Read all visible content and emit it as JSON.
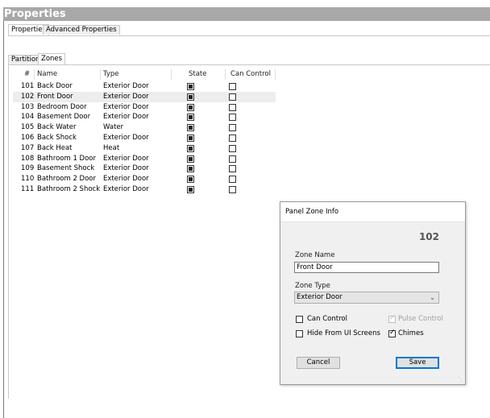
{
  "window": {
    "title": "Properties"
  },
  "top_tabs": [
    {
      "label": "Properties",
      "active": true
    },
    {
      "label": "Advanced Properties",
      "active": false
    }
  ],
  "sub_tabs": [
    {
      "label": "Partitions",
      "active": false
    },
    {
      "label": "Zones",
      "active": true
    }
  ],
  "zones_table": {
    "columns": [
      "#",
      "Name",
      "Type",
      "State",
      "Can Control"
    ],
    "rows": [
      {
        "num": "101",
        "name": "Back Door",
        "type": "Exterior Door",
        "state": true,
        "can_control": false,
        "selected": false
      },
      {
        "num": "102",
        "name": "Front Door",
        "type": "Exterior Door",
        "state": true,
        "can_control": false,
        "selected": true
      },
      {
        "num": "103",
        "name": "Bedroom Door",
        "type": "Exterior Door",
        "state": true,
        "can_control": false,
        "selected": false
      },
      {
        "num": "104",
        "name": "Basement Door",
        "type": "Exterior Door",
        "state": true,
        "can_control": false,
        "selected": false
      },
      {
        "num": "105",
        "name": "Back Water",
        "type": "Water",
        "state": true,
        "can_control": false,
        "selected": false
      },
      {
        "num": "106",
        "name": "Back Shock",
        "type": "Exterior Door",
        "state": true,
        "can_control": false,
        "selected": false
      },
      {
        "num": "107",
        "name": "Back Heat",
        "type": "Heat",
        "state": true,
        "can_control": false,
        "selected": false
      },
      {
        "num": "108",
        "name": "Bathroom 1 Door",
        "type": "Exterior Door",
        "state": true,
        "can_control": false,
        "selected": false
      },
      {
        "num": "109",
        "name": "Basement Shock",
        "type": "Exterior Door",
        "state": true,
        "can_control": false,
        "selected": false
      },
      {
        "num": "110",
        "name": "Bathroom 2 Door",
        "type": "Exterior Door",
        "state": true,
        "can_control": false,
        "selected": false
      },
      {
        "num": "111",
        "name": "Bathroom 2 Shock",
        "type": "Exterior Door",
        "state": true,
        "can_control": false,
        "selected": false
      }
    ]
  },
  "dialog": {
    "title": "Panel Zone Info",
    "zone_number": "102",
    "zone_name_label": "Zone Name",
    "zone_name_value": "Front Door",
    "zone_type_label": "Zone Type",
    "zone_type_value": "Exterior Door",
    "can_control_label": "Can Control",
    "can_control_checked": false,
    "pulse_control_label": "Pulse Control",
    "pulse_control_checked": true,
    "pulse_control_enabled": false,
    "hide_label": "Hide From UI Screens",
    "hide_checked": false,
    "chimes_label": "Chimes",
    "chimes_checked": true,
    "cancel_label": "Cancel",
    "save_label": "Save"
  },
  "icons": {
    "dropdown": "chevron-down-icon",
    "checkmark": "check-icon",
    "resize_grip": "resize-grip-icon"
  },
  "colors": {
    "titlebar_bg": "#a8a8a8",
    "selected_row_bg": "#ededed",
    "default_button_border": "#0078d7"
  }
}
